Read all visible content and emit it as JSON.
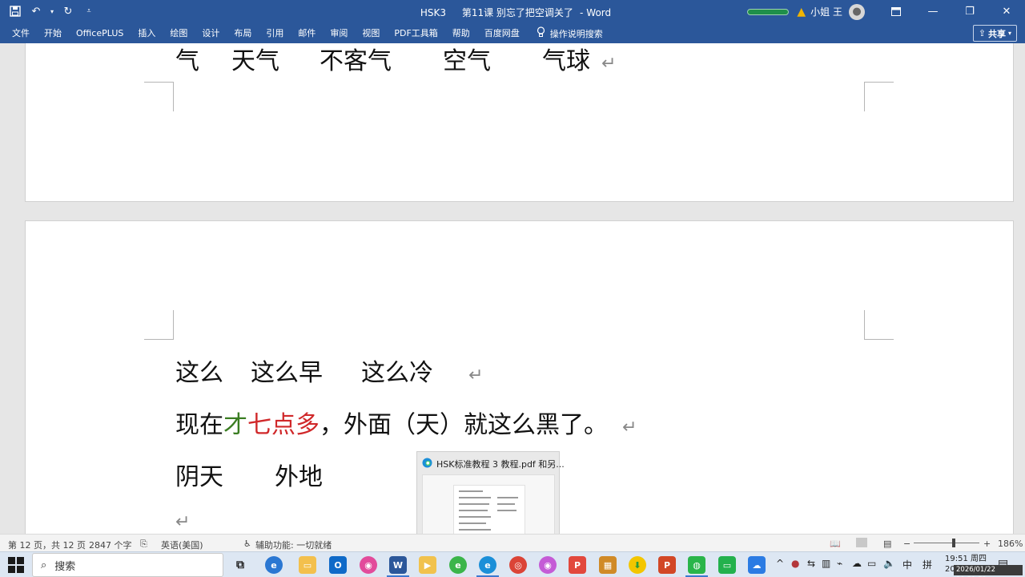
{
  "titlebar": {
    "doc_name": "HSK3",
    "doc_title": "第11课 别忘了把空调关了",
    "separator": "-",
    "app_name": "Word",
    "user_name": "小姐 王"
  },
  "ribbon": {
    "tabs": [
      "文件",
      "开始",
      "OfficePLUS",
      "插入",
      "绘图",
      "设计",
      "布局",
      "引用",
      "邮件",
      "审阅",
      "视图",
      "PDF工具箱",
      "帮助",
      "百度网盘"
    ],
    "tell_me": "操作说明搜索",
    "share_label": "共享"
  },
  "document": {
    "page1_line": [
      "气",
      "天气",
      "不客气",
      "空气",
      "气球"
    ],
    "page2": {
      "line1": [
        "这么",
        "这么早",
        "这么冷"
      ],
      "line2": {
        "part1": "现在",
        "part2": "才",
        "part3": "七点多",
        "part4": "，外面（天）就这么黑了。"
      },
      "line3": [
        "阴天",
        "外地"
      ],
      "para_mark": "↵"
    }
  },
  "statusbar": {
    "page_info": "第 12 页，共 12 页",
    "word_count": "2847 个字",
    "language": "英语(美国)",
    "accessibility": "辅助功能: 一切就绪",
    "zoom": "186%"
  },
  "taskbar": {
    "search_placeholder": "搜索",
    "time": "19:51 周四",
    "date": "2026/01/22",
    "ime_mode": "中",
    "ime_layout": "拼",
    "timestamp_overlay": "2026/01/22 19:51:52"
  },
  "thumbnail": {
    "title": "HSK标准教程 3 教程.pdf 和另..."
  },
  "colors": {
    "brand": "#2b579a",
    "green_text": "#3a7d22",
    "red_text": "#d0282a"
  }
}
